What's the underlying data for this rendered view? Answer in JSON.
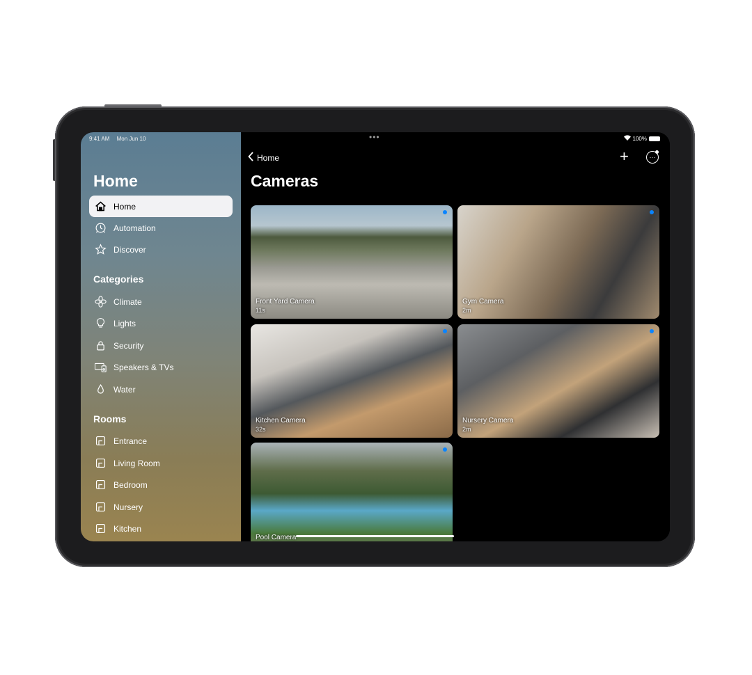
{
  "status_bar": {
    "time": "9:41 AM",
    "date": "Mon Jun 10",
    "battery": "100%",
    "multitask_dots": "•••"
  },
  "sidebar": {
    "title": "Home",
    "items": [
      {
        "label": "Home",
        "icon": "house-icon",
        "active": true
      },
      {
        "label": "Automation",
        "icon": "clock-icon"
      },
      {
        "label": "Discover",
        "icon": "star-icon"
      }
    ],
    "categories_header": "Categories",
    "categories": [
      {
        "label": "Climate",
        "icon": "fan-icon"
      },
      {
        "label": "Lights",
        "icon": "lightbulb-icon"
      },
      {
        "label": "Security",
        "icon": "lock-icon"
      },
      {
        "label": "Speakers & TVs",
        "icon": "tv-speaker-icon"
      },
      {
        "label": "Water",
        "icon": "water-drop-icon"
      }
    ],
    "rooms_header": "Rooms",
    "rooms": [
      {
        "label": "Entrance",
        "icon": "room-icon"
      },
      {
        "label": "Living Room",
        "icon": "room-icon"
      },
      {
        "label": "Bedroom",
        "icon": "room-icon"
      },
      {
        "label": "Nursery",
        "icon": "room-icon"
      },
      {
        "label": "Kitchen",
        "icon": "room-icon"
      }
    ]
  },
  "main": {
    "back_label": "Home",
    "title": "Cameras",
    "cameras": [
      {
        "name": "Front Yard Camera",
        "age": "11s"
      },
      {
        "name": "Gym Camera",
        "age": "2m"
      },
      {
        "name": "Kitchen Camera",
        "age": "32s"
      },
      {
        "name": "Nursery Camera",
        "age": "2m"
      },
      {
        "name": "Pool Camera",
        "age": ""
      }
    ]
  },
  "colors": {
    "accent": "#0a84ff",
    "active_item_bg": "#f2f2f4"
  }
}
